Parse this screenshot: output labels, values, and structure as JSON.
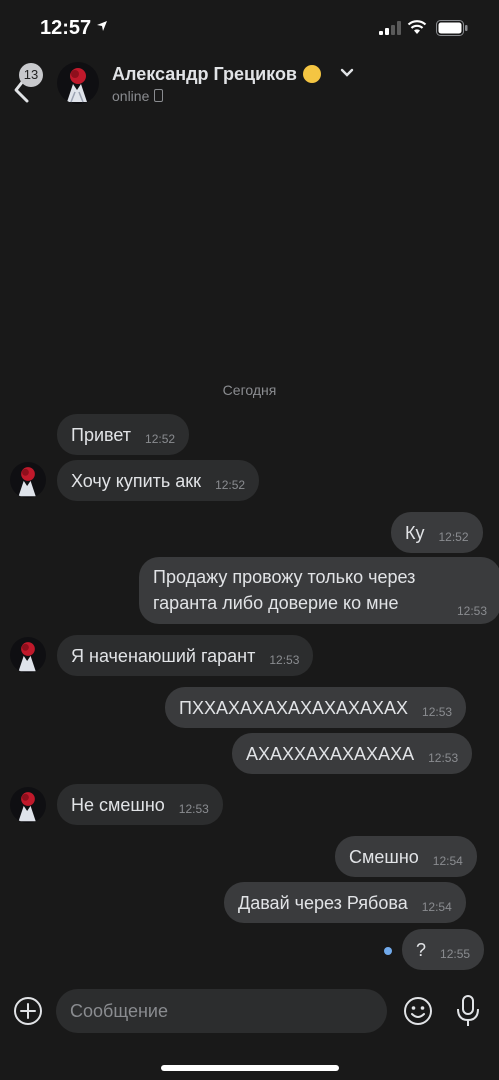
{
  "status_bar": {
    "time": "12:57"
  },
  "header": {
    "back_badge": "13",
    "contact_name": "Александр Грециков",
    "presence": "online"
  },
  "chat": {
    "date_separator": "Сегодня",
    "messages": [
      {
        "text": "Привет",
        "time": "12:52",
        "direction": "in"
      },
      {
        "text": "Хочу купить акк",
        "time": "12:52",
        "direction": "in"
      },
      {
        "text": "Ку",
        "time": "12:52",
        "direction": "out"
      },
      {
        "text_line1": "Продажу провожу только через",
        "text_line2": "гаранта либо доверие ко мне",
        "time": "12:53",
        "direction": "out"
      },
      {
        "text": "Я наченаюший гарант",
        "time": "12:53",
        "direction": "in"
      },
      {
        "text": "ПХХАХАХАХАХАХАХАХАХ",
        "time": "12:53",
        "direction": "out"
      },
      {
        "text": "АХАХХАХАХАХАХА",
        "time": "12:53",
        "direction": "out"
      },
      {
        "text": "Не смешно",
        "time": "12:53",
        "direction": "in"
      },
      {
        "text": "Смешно",
        "time": "12:54",
        "direction": "out"
      },
      {
        "text": "Давай через Рябова",
        "time": "12:54",
        "direction": "out"
      },
      {
        "text": "?",
        "time": "12:55",
        "direction": "out",
        "unread": true
      }
    ]
  },
  "composer": {
    "placeholder": "Сообщение"
  },
  "colors": {
    "background": "#191919",
    "bubble_in": "#2c2d2e",
    "bubble_out": "#3a3b3d",
    "unread": "#71aaeb"
  },
  "icons": [
    "back-chevron-icon",
    "emoji-icon",
    "chevron-down-icon",
    "phone-icon",
    "add-icon",
    "smile-icon",
    "microphone-icon"
  ]
}
